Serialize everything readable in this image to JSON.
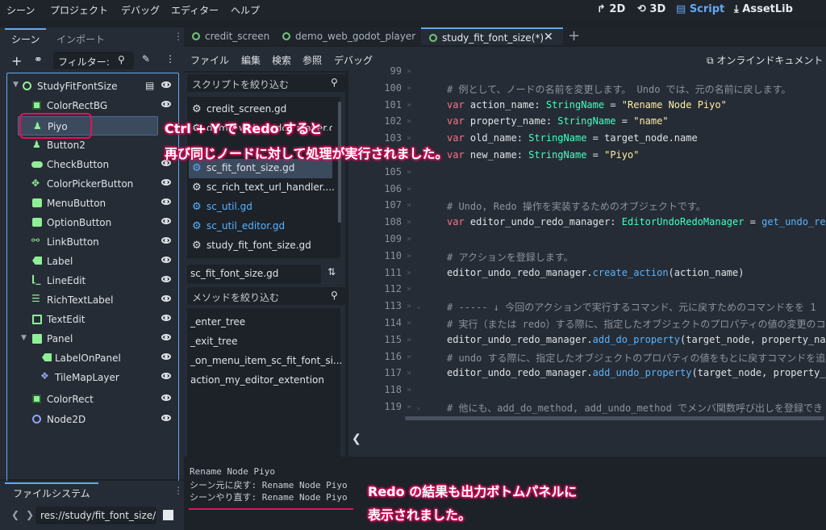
{
  "menubar": {
    "items": [
      "シーン",
      "プロジェクト",
      "デバッグ",
      "エディター",
      "ヘルプ"
    ],
    "workspaces": [
      "2D",
      "3D",
      "Script",
      "AssetLib"
    ],
    "active_workspace": "Script"
  },
  "scene_dock": {
    "tabs": [
      "シーン",
      "インポート"
    ],
    "filter_placeholder": "フィルター:",
    "nodes": [
      {
        "name": "StudyFitFontSize",
        "icon": "node-circle-icon",
        "color": "#8eef97"
      },
      {
        "name": "ColorRectBG",
        "icon": "color-rect-icon",
        "color": "#8eef97"
      },
      {
        "name": "Piyo",
        "icon": "button-icon",
        "color": "#8eef97"
      },
      {
        "name": "Button2",
        "icon": "button-icon",
        "color": "#8eef97"
      },
      {
        "name": "CheckButton",
        "icon": "toggle-icon",
        "color": "#8eef97"
      },
      {
        "name": "ColorPickerButton",
        "icon": "color-picker-icon",
        "color": "#8eef97"
      },
      {
        "name": "MenuButton",
        "icon": "menu-button-icon",
        "color": "#8eef97"
      },
      {
        "name": "OptionButton",
        "icon": "option-button-icon",
        "color": "#8eef97"
      },
      {
        "name": "LinkButton",
        "icon": "link-icon",
        "color": "#8eef97"
      },
      {
        "name": "Label",
        "icon": "label-icon",
        "color": "#8eef97"
      },
      {
        "name": "LineEdit",
        "icon": "line-edit-icon",
        "color": "#8eef97"
      },
      {
        "name": "RichTextLabel",
        "icon": "rich-text-icon",
        "color": "#8eef97"
      },
      {
        "name": "TextEdit",
        "icon": "text-edit-icon",
        "color": "#8eef97"
      },
      {
        "name": "Panel",
        "icon": "panel-icon",
        "color": "#8eef97"
      },
      {
        "name": "LabelOnPanel",
        "icon": "label-icon",
        "color": "#8eef97"
      },
      {
        "name": "TileMapLayer",
        "icon": "tilemap-icon",
        "color": "#8da5f3"
      },
      {
        "name": "ColorRect",
        "icon": "color-rect-icon",
        "color": "#8eef97"
      },
      {
        "name": "Node2D",
        "icon": "node2d-circle-icon",
        "color": "#8da5f3"
      }
    ]
  },
  "filesystem_dock": {
    "title": "ファイルシステム",
    "path": "res://study/fit_font_size/"
  },
  "editor_tabs": [
    "credit_screen",
    "demo_web_godot_player",
    "study_fit_font_size(*)"
  ],
  "script_menu": [
    "ファイル",
    "編集",
    "検索",
    "参照",
    "デバッグ"
  ],
  "online_docs": "オンラインドキュメント",
  "script_filter_placeholder": "スクリプトを絞り込む",
  "scripts": [
    {
      "name": "credit_screen.gd",
      "selected": false,
      "color": "#dfe3e8"
    },
    {
      "name": "demo_web_godot_player.gd",
      "selected": false,
      "color": "#dfe3e8"
    },
    {
      "name": "sc_fit_font_size.gd",
      "selected": true,
      "color": "#dfe3e8"
    },
    {
      "name": "sc_rich_text_url_handler....",
      "selected": false,
      "color": "#dfe3e8"
    },
    {
      "name": "sc_util.gd",
      "selected": false,
      "color": "#57b3ff"
    },
    {
      "name": "sc_util_editor.gd",
      "selected": false,
      "color": "#57b3ff"
    },
    {
      "name": "study_fit_font_size.gd",
      "selected": false,
      "color": "#dfe3e8"
    }
  ],
  "current_script": "sc_fit_font_size.gd",
  "method_filter_placeholder": "メソッドを絞り込む",
  "methods": [
    "_enter_tree",
    "_exit_tree",
    "_on_menu_item_sc_fit_font_si...",
    "action_my_editor_extention"
  ],
  "code_lines": [
    {
      "n": "99",
      "html": ""
    },
    {
      "n": "100",
      "html": "<span class='cm'># 例として、ノードの名前を変更します。 Undo では、元の名前に戻します。</span>"
    },
    {
      "n": "101",
      "html": "<span class='kw'>var</span> action_name: <span class='ty'>StringName</span> = <span class='st'>\"Rename Node Piyo\"</span>"
    },
    {
      "n": "102",
      "html": "<span class='kw'>var</span> property_name: <span class='ty'>StringName</span> = <span class='st'>\"name\"</span>"
    },
    {
      "n": "103",
      "html": "<span class='kw'>var</span> old_name: <span class='ty'>StringName</span> = target_node.name"
    },
    {
      "n": "104",
      "html": "<span class='kw'>var</span> new_name: <span class='ty'>StringName</span> = <span class='st'>\"Piyo\"</span>"
    },
    {
      "n": "105",
      "html": ""
    },
    {
      "n": "106",
      "html": ""
    },
    {
      "n": "107",
      "html": "<span class='cm'># Undo, Redo 操作を実装するためのオブジェクトです。</span>"
    },
    {
      "n": "108",
      "html": "<span class='kw'>var</span> editor_undo_redo_manager: <span class='ty'>EditorUndoRedoManager</span> = <span class='fn'>get_undo_re</span>"
    },
    {
      "n": "109",
      "html": ""
    },
    {
      "n": "110",
      "html": "<span class='cm'># アクションを登録します。</span>"
    },
    {
      "n": "111",
      "html": "editor_undo_redo_manager.<span class='fn'>create_action</span>(action_name)"
    },
    {
      "n": "112",
      "html": ""
    },
    {
      "n": "113",
      "html": "<span class='cm'># ----- ↓ 今回のアクションで実行するコマンド、元に戻すためのコマンドをを 1</span>"
    },
    {
      "n": "114",
      "html": "<span class='cm'># 実行（または redo）する際に、指定したオブジェクトのプロパティの値の変更のコ</span>"
    },
    {
      "n": "115",
      "html": "editor_undo_redo_manager.<span class='fn'>add_do_property</span>(target_node, property_na"
    },
    {
      "n": "116",
      "html": "<span class='cm'># undo する際に、指定したオブジェクトのプロパティの値をもとに戻すコマンドを追</span>"
    },
    {
      "n": "117",
      "html": "editor_undo_redo_manager.<span class='fn'>add_undo_property</span>(target_node, property_"
    },
    {
      "n": "118",
      "html": ""
    },
    {
      "n": "119",
      "html": "<span class='cm'># 他にも、add_do_method, add_undo_method でメンバ関数呼び出しを登録でき</span>"
    }
  ],
  "output_lines": [
    "Rename Node Piyo",
    "シーン元に戻す: Rename Node Piyo",
    "シーンやり直す: Rename Node Piyo"
  ],
  "callouts": {
    "top_line1": "Ctrl + Y で Redo すると",
    "top_line2": "再び同じノードに対して処理が実行されました。",
    "bottom_line1": "Redo の結果も出力ボトムパネルに",
    "bottom_line2": "表示されました。"
  },
  "colors": {
    "accent": "#62a8f5",
    "highlight_box": "#e0125f",
    "node_green": "#8eef97",
    "node_blue": "#8da5f3"
  }
}
